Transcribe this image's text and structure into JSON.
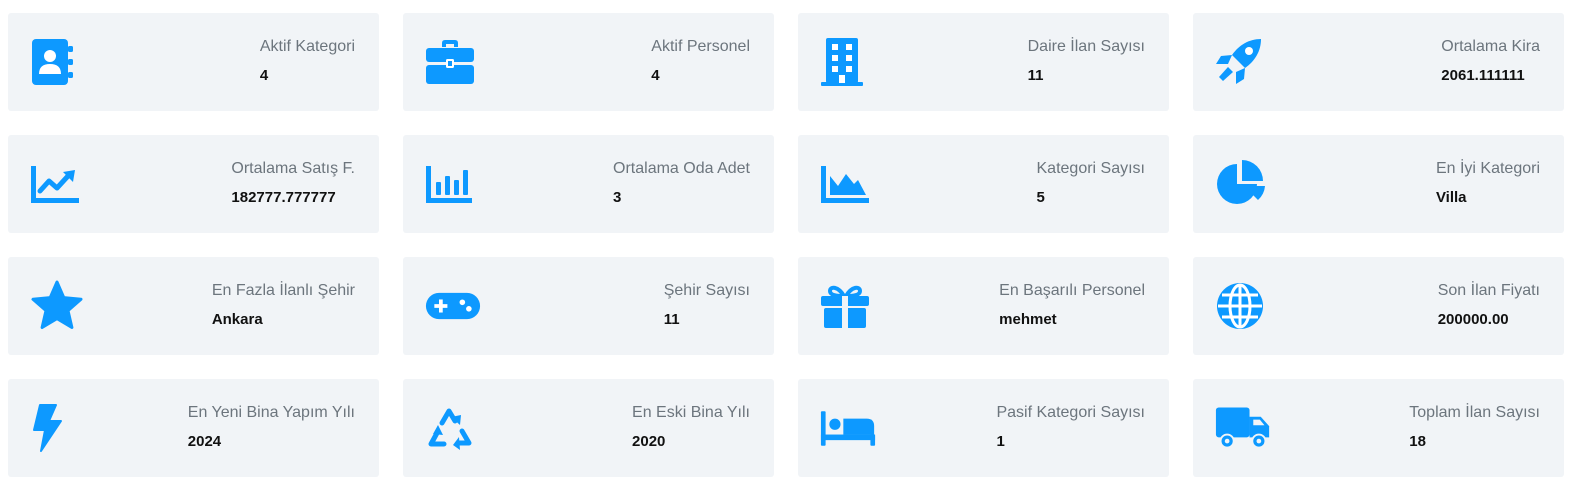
{
  "theme": {
    "icon_color": "#0d99ff",
    "card_background": "#f1f4f7"
  },
  "cards": [
    {
      "icon": "contact-book-icon",
      "label": "Aktif Kategori",
      "value": "4"
    },
    {
      "icon": "briefcase-icon",
      "label": "Aktif Personel",
      "value": "4"
    },
    {
      "icon": "building-icon",
      "label": "Daire İlan Sayısı",
      "value": "11"
    },
    {
      "icon": "rocket-icon",
      "label": "Ortalama Kira",
      "value": "2061.111111"
    },
    {
      "icon": "chart-line-icon",
      "label": "Ortalama Satış F.",
      "value": "182777.777777"
    },
    {
      "icon": "chart-bar-icon",
      "label": "Ortalama Oda Adet",
      "value": "3"
    },
    {
      "icon": "chart-area-icon",
      "label": "Kategori Sayısı",
      "value": "5"
    },
    {
      "icon": "chart-pie-icon",
      "label": "En İyi Kategori",
      "value": "Villa"
    },
    {
      "icon": "star-icon",
      "label": "En Fazla İlanlı Şehir",
      "value": "Ankara"
    },
    {
      "icon": "gamepad-icon",
      "label": "Şehir Sayısı",
      "value": "11"
    },
    {
      "icon": "gift-icon",
      "label": "En Başarılı Personel",
      "value": "mehmet"
    },
    {
      "icon": "globe-icon",
      "label": "Son İlan Fiyatı",
      "value": "200000.00"
    },
    {
      "icon": "bolt-icon",
      "label": "En Yeni Bina Yapım Yılı",
      "value": "2024"
    },
    {
      "icon": "recycle-icon",
      "label": "En Eski Bina Yılı",
      "value": "2020"
    },
    {
      "icon": "bed-icon",
      "label": "Pasif Kategori Sayısı",
      "value": "1"
    },
    {
      "icon": "truck-icon",
      "label": "Toplam İlan Sayısı",
      "value": "18"
    }
  ]
}
